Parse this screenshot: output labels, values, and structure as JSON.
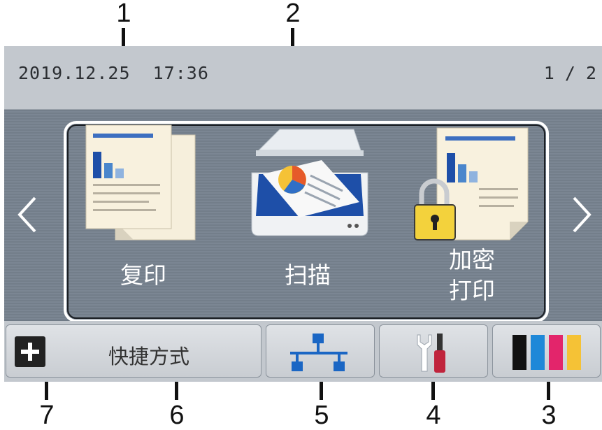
{
  "status_bar": {
    "datetime": "2019.12.25  17:36",
    "page_indicator": "1 / 2"
  },
  "features": [
    {
      "label": "复印",
      "icon": "copy-icon"
    },
    {
      "label": "扫描",
      "icon": "scanner-icon"
    },
    {
      "label_line1": "加密",
      "label_line2": "打印",
      "icon": "secure-print-icon"
    }
  ],
  "bottom_bar": {
    "shortcuts_label": "快捷方式",
    "add_icon": "plus-icon",
    "network_icon": "network-icon",
    "settings_icon": "tools-icon",
    "ink_icon": "ink-levels-icon",
    "ink_colors": [
      "#111111",
      "#1e88d8",
      "#e3256b",
      "#f5c236"
    ]
  },
  "callouts": [
    "1",
    "2",
    "3",
    "4",
    "5",
    "6",
    "7"
  ],
  "colors": {
    "screen_bg": "#7b8693",
    "bar_bg": "#c3c8ce",
    "network_blue": "#1a66c4"
  }
}
